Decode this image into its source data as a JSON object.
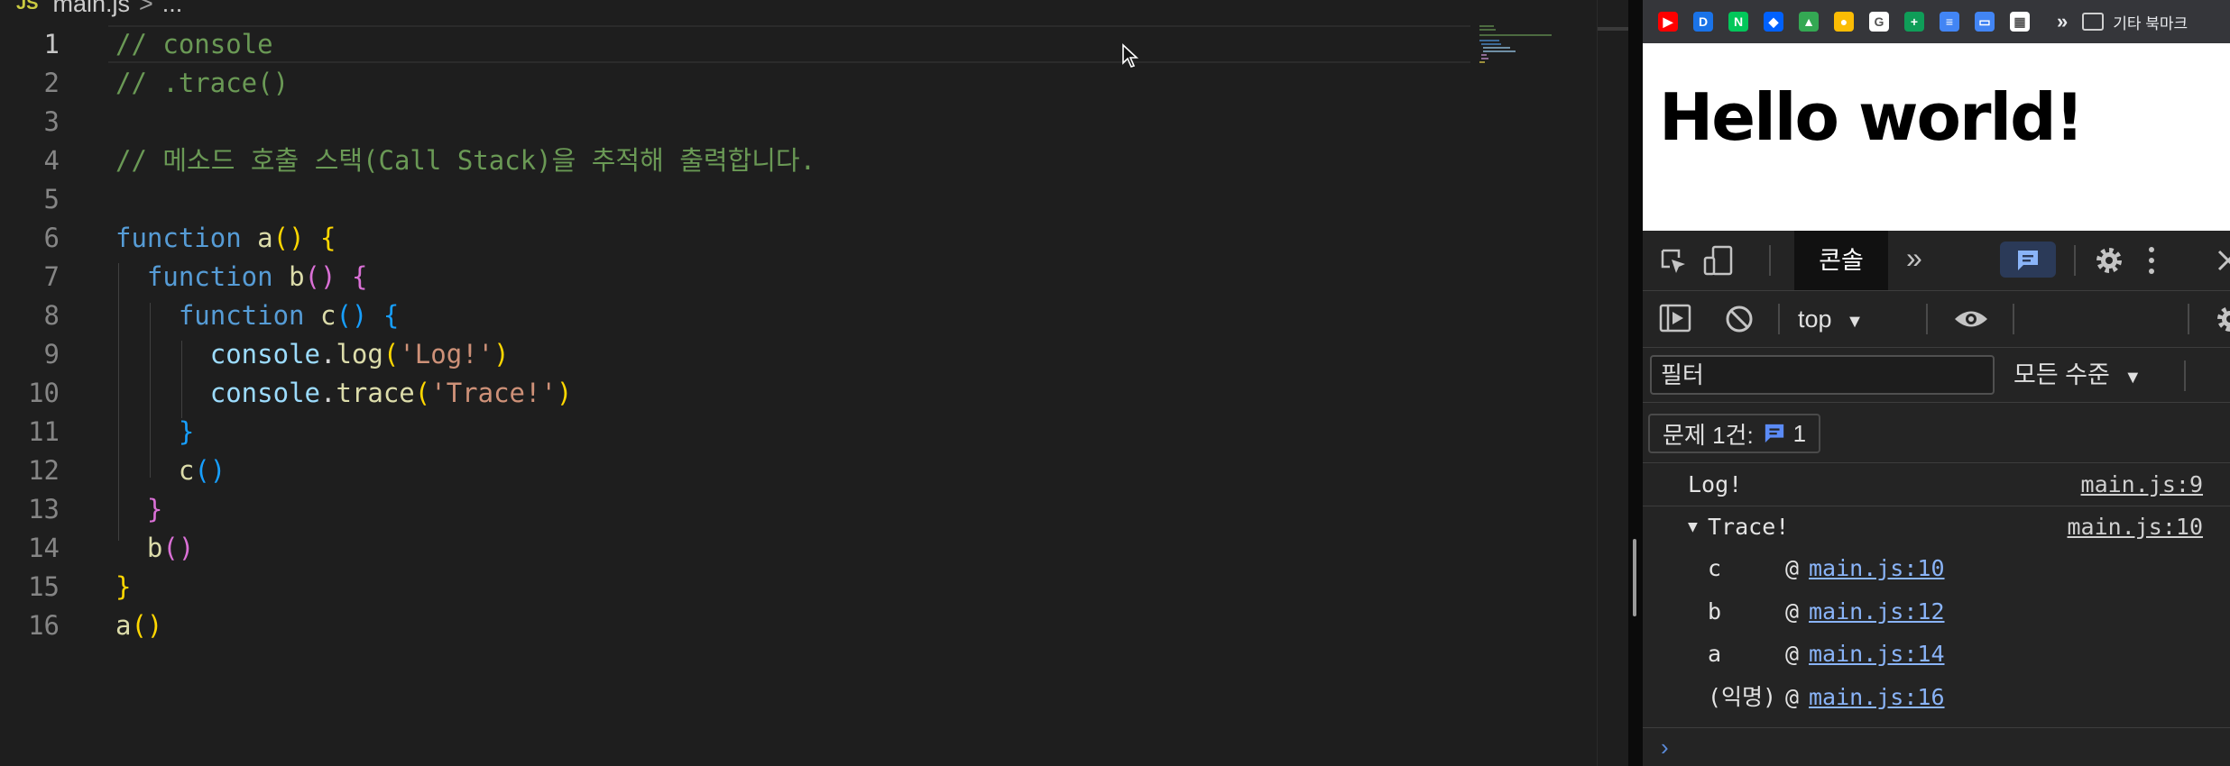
{
  "editor": {
    "breadcrumb": {
      "badge": "JS",
      "file": "main.js",
      "separator": ">",
      "trail": "..."
    },
    "lines": [
      {
        "n": "1",
        "tokens": [
          {
            "t": "// console",
            "c": "c-com"
          }
        ]
      },
      {
        "n": "2",
        "tokens": [
          {
            "t": "// .trace()",
            "c": "c-com"
          }
        ]
      },
      {
        "n": "3",
        "tokens": []
      },
      {
        "n": "4",
        "tokens": [
          {
            "t": "// 메소드 호출 스택(Call Stack)을 추적해 출력합니다.",
            "c": "c-com"
          }
        ]
      },
      {
        "n": "5",
        "tokens": []
      },
      {
        "n": "6",
        "tokens": [
          {
            "t": "function",
            "c": "c-kw"
          },
          {
            "t": " "
          },
          {
            "t": "a",
            "c": "c-fn"
          },
          {
            "t": "()",
            "c": "b1"
          },
          {
            "t": " "
          },
          {
            "t": "{",
            "c": "b1"
          }
        ]
      },
      {
        "n": "7",
        "tokens": [
          {
            "t": "  "
          },
          {
            "t": "function",
            "c": "c-kw"
          },
          {
            "t": " "
          },
          {
            "t": "b",
            "c": "c-fn"
          },
          {
            "t": "()",
            "c": "b2"
          },
          {
            "t": " "
          },
          {
            "t": "{",
            "c": "b2"
          }
        ]
      },
      {
        "n": "8",
        "tokens": [
          {
            "t": "    "
          },
          {
            "t": "function",
            "c": "c-kw"
          },
          {
            "t": " "
          },
          {
            "t": "c",
            "c": "c-fn"
          },
          {
            "t": "()",
            "c": "b3"
          },
          {
            "t": " "
          },
          {
            "t": "{",
            "c": "b3"
          }
        ]
      },
      {
        "n": "9",
        "tokens": [
          {
            "t": "      "
          },
          {
            "t": "console",
            "c": "c-var"
          },
          {
            "t": ".",
            "c": "c-p"
          },
          {
            "t": "log",
            "c": "c-fn"
          },
          {
            "t": "(",
            "c": "b1"
          },
          {
            "t": "'Log!'",
            "c": "c-str"
          },
          {
            "t": ")",
            "c": "b1"
          }
        ]
      },
      {
        "n": "10",
        "tokens": [
          {
            "t": "      "
          },
          {
            "t": "console",
            "c": "c-var"
          },
          {
            "t": ".",
            "c": "c-p"
          },
          {
            "t": "trace",
            "c": "c-fn"
          },
          {
            "t": "(",
            "c": "b1"
          },
          {
            "t": "'Trace!'",
            "c": "c-str"
          },
          {
            "t": ")",
            "c": "b1"
          }
        ]
      },
      {
        "n": "11",
        "tokens": [
          {
            "t": "    "
          },
          {
            "t": "}",
            "c": "b3"
          }
        ]
      },
      {
        "n": "12",
        "tokens": [
          {
            "t": "    "
          },
          {
            "t": "c",
            "c": "c-fn"
          },
          {
            "t": "()",
            "c": "b3"
          }
        ]
      },
      {
        "n": "13",
        "tokens": [
          {
            "t": "  "
          },
          {
            "t": "}",
            "c": "b2"
          }
        ]
      },
      {
        "n": "14",
        "tokens": [
          {
            "t": "  "
          },
          {
            "t": "b",
            "c": "c-fn"
          },
          {
            "t": "()",
            "c": "b2"
          }
        ]
      },
      {
        "n": "15",
        "tokens": [
          {
            "t": "}",
            "c": "b1"
          }
        ]
      },
      {
        "n": "16",
        "tokens": [
          {
            "t": "a",
            "c": "c-fn"
          },
          {
            "t": "()",
            "c": "b1"
          }
        ]
      }
    ],
    "active_line": "1"
  },
  "browser": {
    "bookmarks": {
      "items": [
        {
          "name": "youtube-bookmark-icon",
          "color": "#ff0000",
          "glyph": "▶"
        },
        {
          "name": "d-bookmark-icon",
          "color": "#1a73e8",
          "glyph": "D"
        },
        {
          "name": "n-bookmark-icon",
          "color": "#03c75a",
          "glyph": "N"
        },
        {
          "name": "dropbox-bookmark-icon",
          "color": "#0061fe",
          "glyph": "◆"
        },
        {
          "name": "drive-bookmark-icon",
          "color": "#34a853",
          "glyph": "▲"
        },
        {
          "name": "keep-bookmark-icon",
          "color": "#fbbc04",
          "glyph": "●"
        },
        {
          "name": "google-bookmark-icon",
          "color": "#ffffff",
          "glyph": "G"
        },
        {
          "name": "sheets-bookmark-icon",
          "color": "#0f9d58",
          "glyph": "+"
        },
        {
          "name": "docs-bookmark-icon",
          "color": "#4285f4",
          "glyph": "≡"
        },
        {
          "name": "slides-bookmark-icon",
          "color": "#4285f4",
          "glyph": "▭"
        },
        {
          "name": "calendar-bookmark-icon",
          "color": "#ffffff",
          "glyph": "▦"
        }
      ],
      "more": "»",
      "other_label": "기타 북마크"
    },
    "page_heading": "Hello world!",
    "devtools": {
      "tab_console": "콘솔",
      "tab_more": "»",
      "context": "top",
      "filter_placeholder": "필터",
      "levels": "모든 수준",
      "issues_label": "문제 1건:",
      "issues_count": "1",
      "log_text": "Log!",
      "log_src": "main.js:9",
      "trace_text": "Trace!",
      "trace_src": "main.js:10",
      "stack": [
        {
          "fn": "c",
          "at": "@",
          "src": "main.js:10"
        },
        {
          "fn": "b",
          "at": "@",
          "src": "main.js:12"
        },
        {
          "fn": "a",
          "at": "@",
          "src": "main.js:14"
        },
        {
          "fn": "(익명)",
          "at": "@",
          "src": "main.js:16"
        }
      ],
      "prompt": "›"
    }
  },
  "colors": {
    "accent": "#8ab4f8",
    "issue_blue": "#5b8bf7",
    "editor_bg": "#1e1e1e"
  }
}
